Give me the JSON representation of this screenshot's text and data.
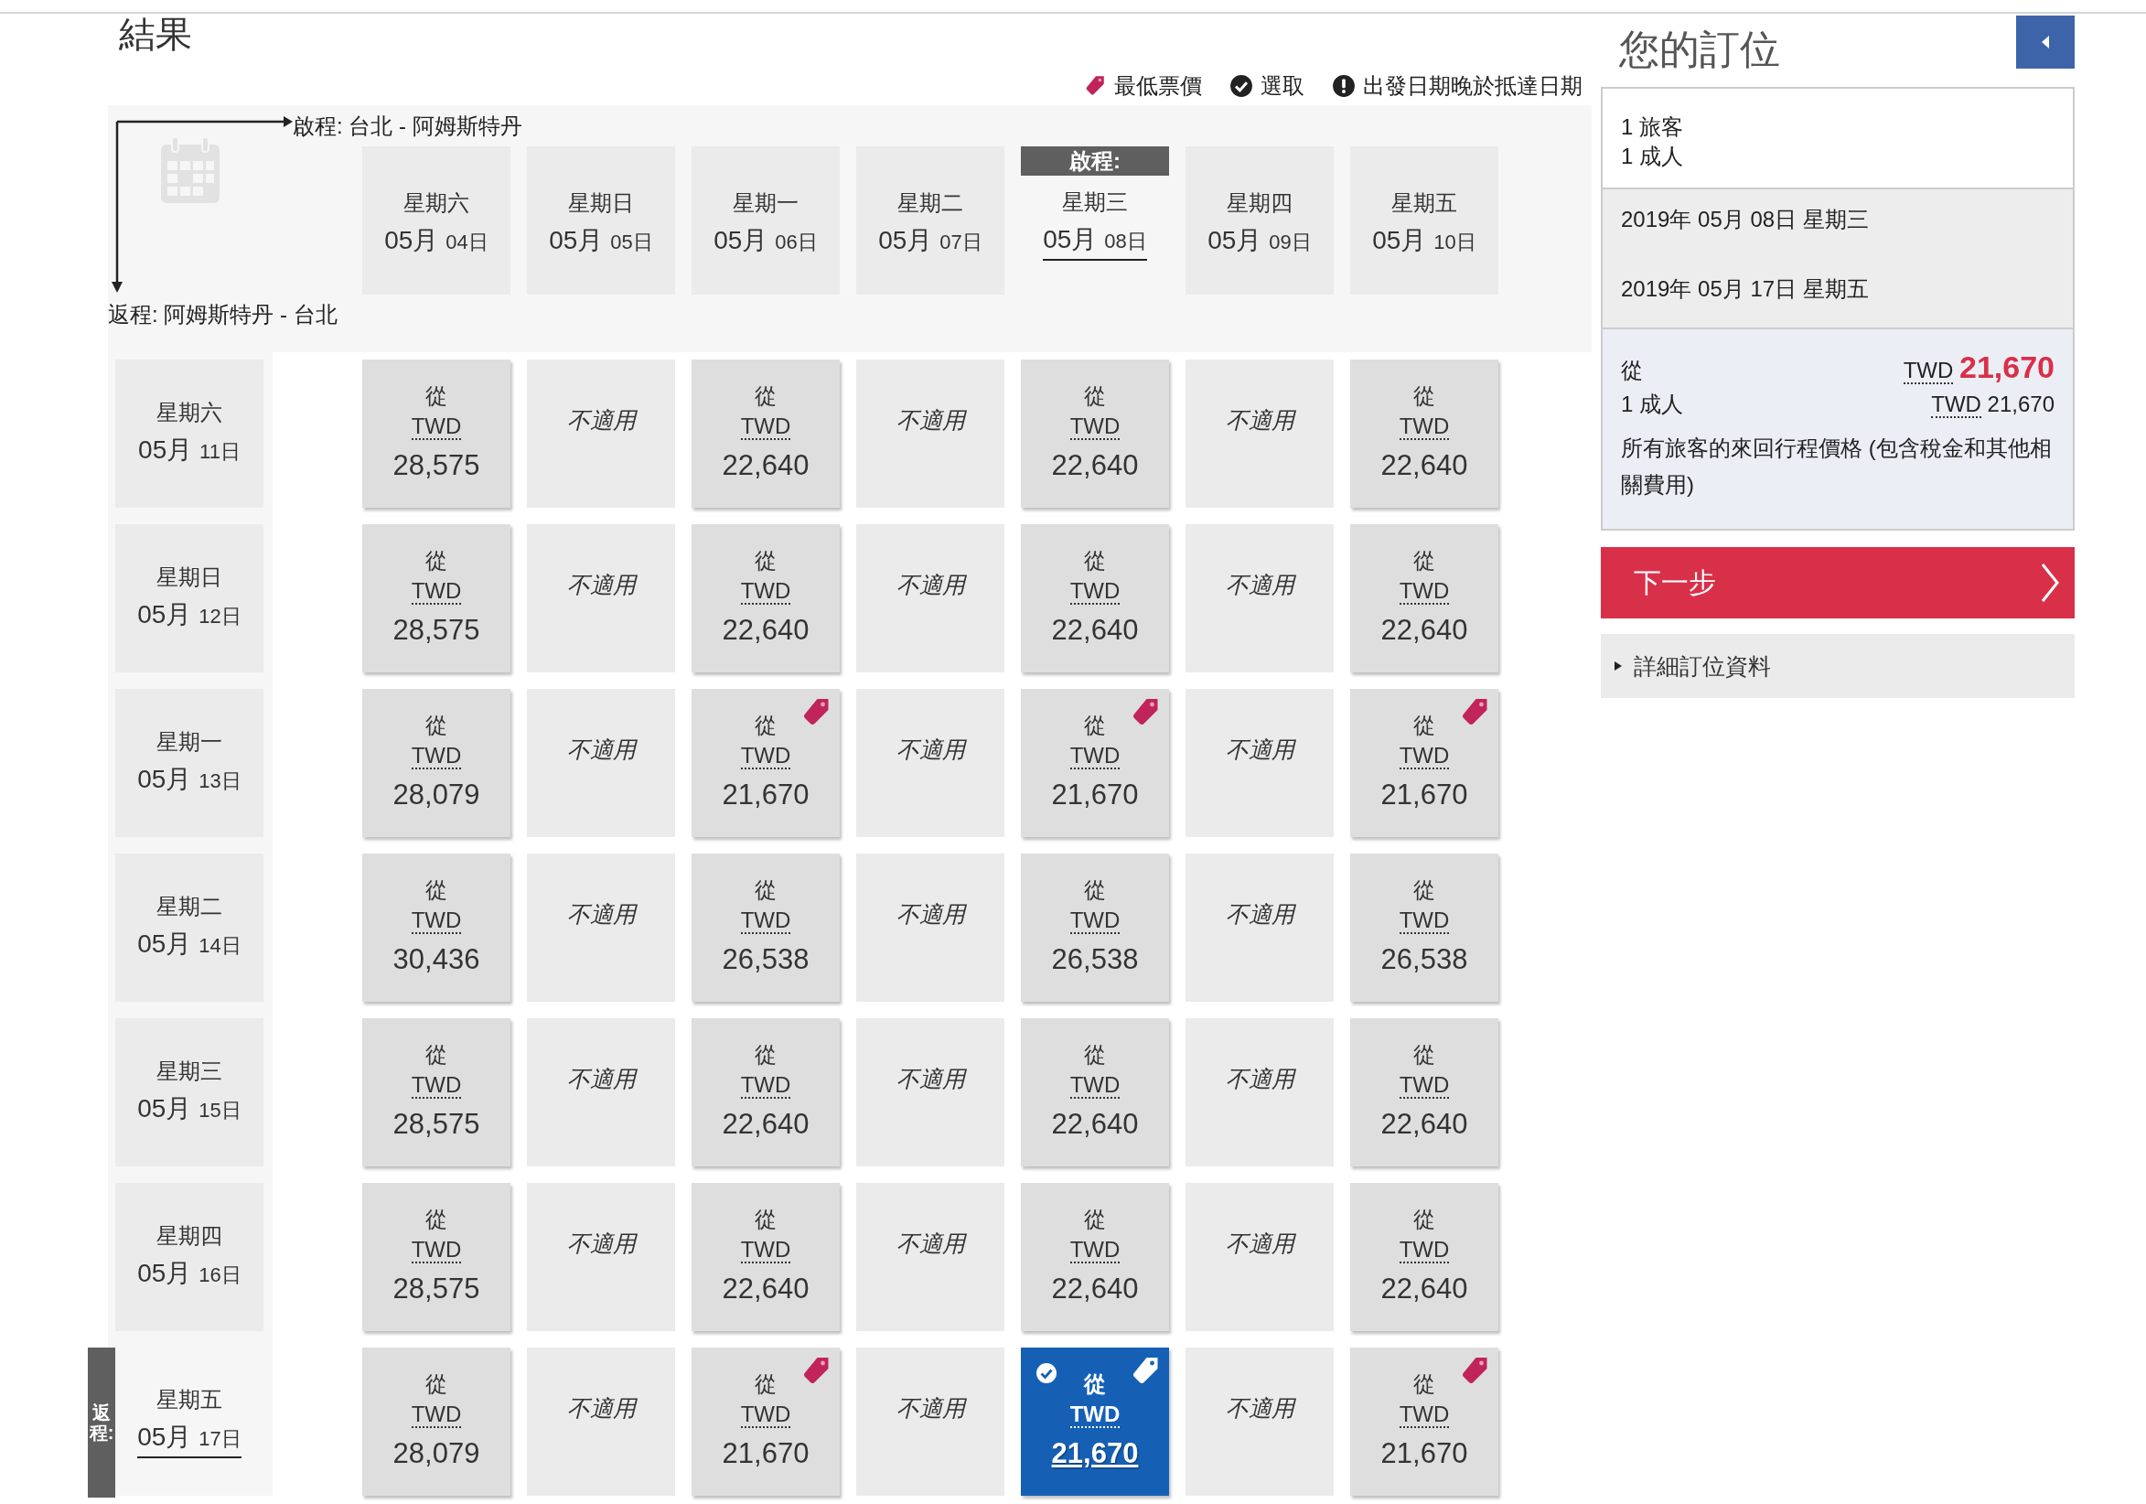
{
  "title": "結果",
  "legend": [
    {
      "kind": "lowest",
      "label": "最低票價"
    },
    {
      "kind": "selected",
      "label": "選取"
    },
    {
      "kind": "warning",
      "label": "出發日期晚於抵達日期"
    }
  ],
  "outbound_route": "啟程: 台北 - 阿姆斯特丹",
  "return_route": "返程: 阿姆斯特丹 - 台北",
  "outbound_badge": "啟程:",
  "return_badge": "返程:",
  "columns": [
    {
      "weekday": "星期六",
      "month": "05月",
      "day": "04日",
      "selected": false
    },
    {
      "weekday": "星期日",
      "month": "05月",
      "day": "05日",
      "selected": false
    },
    {
      "weekday": "星期一",
      "month": "05月",
      "day": "06日",
      "selected": false
    },
    {
      "weekday": "星期二",
      "month": "05月",
      "day": "07日",
      "selected": false
    },
    {
      "weekday": "星期三",
      "month": "05月",
      "day": "08日",
      "selected": true
    },
    {
      "weekday": "星期四",
      "month": "05月",
      "day": "09日",
      "selected": false
    },
    {
      "weekday": "星期五",
      "month": "05月",
      "day": "10日",
      "selected": false
    }
  ],
  "rows": [
    {
      "weekday": "星期六",
      "month": "05月",
      "day": "11日",
      "selected": false,
      "cells": [
        {
          "kind": "fare",
          "from": "從",
          "currency": "TWD",
          "amount": "28,575",
          "lowest": false,
          "selected": false
        },
        {
          "kind": "na",
          "text": "不適用"
        },
        {
          "kind": "fare",
          "from": "從",
          "currency": "TWD",
          "amount": "22,640",
          "lowest": false,
          "selected": false
        },
        {
          "kind": "na",
          "text": "不適用"
        },
        {
          "kind": "fare",
          "from": "從",
          "currency": "TWD",
          "amount": "22,640",
          "lowest": false,
          "selected": false
        },
        {
          "kind": "na",
          "text": "不適用"
        },
        {
          "kind": "fare",
          "from": "從",
          "currency": "TWD",
          "amount": "22,640",
          "lowest": false,
          "selected": false
        }
      ]
    },
    {
      "weekday": "星期日",
      "month": "05月",
      "day": "12日",
      "selected": false,
      "cells": [
        {
          "kind": "fare",
          "from": "從",
          "currency": "TWD",
          "amount": "28,575",
          "lowest": false,
          "selected": false
        },
        {
          "kind": "na",
          "text": "不適用"
        },
        {
          "kind": "fare",
          "from": "從",
          "currency": "TWD",
          "amount": "22,640",
          "lowest": false,
          "selected": false
        },
        {
          "kind": "na",
          "text": "不適用"
        },
        {
          "kind": "fare",
          "from": "從",
          "currency": "TWD",
          "amount": "22,640",
          "lowest": false,
          "selected": false
        },
        {
          "kind": "na",
          "text": "不適用"
        },
        {
          "kind": "fare",
          "from": "從",
          "currency": "TWD",
          "amount": "22,640",
          "lowest": false,
          "selected": false
        }
      ]
    },
    {
      "weekday": "星期一",
      "month": "05月",
      "day": "13日",
      "selected": false,
      "cells": [
        {
          "kind": "fare",
          "from": "從",
          "currency": "TWD",
          "amount": "28,079",
          "lowest": false,
          "selected": false
        },
        {
          "kind": "na",
          "text": "不適用"
        },
        {
          "kind": "fare",
          "from": "從",
          "currency": "TWD",
          "amount": "21,670",
          "lowest": true,
          "selected": false
        },
        {
          "kind": "na",
          "text": "不適用"
        },
        {
          "kind": "fare",
          "from": "從",
          "currency": "TWD",
          "amount": "21,670",
          "lowest": true,
          "selected": false
        },
        {
          "kind": "na",
          "text": "不適用"
        },
        {
          "kind": "fare",
          "from": "從",
          "currency": "TWD",
          "amount": "21,670",
          "lowest": true,
          "selected": false
        }
      ]
    },
    {
      "weekday": "星期二",
      "month": "05月",
      "day": "14日",
      "selected": false,
      "cells": [
        {
          "kind": "fare",
          "from": "從",
          "currency": "TWD",
          "amount": "30,436",
          "lowest": false,
          "selected": false
        },
        {
          "kind": "na",
          "text": "不適用"
        },
        {
          "kind": "fare",
          "from": "從",
          "currency": "TWD",
          "amount": "26,538",
          "lowest": false,
          "selected": false
        },
        {
          "kind": "na",
          "text": "不適用"
        },
        {
          "kind": "fare",
          "from": "從",
          "currency": "TWD",
          "amount": "26,538",
          "lowest": false,
          "selected": false
        },
        {
          "kind": "na",
          "text": "不適用"
        },
        {
          "kind": "fare",
          "from": "從",
          "currency": "TWD",
          "amount": "26,538",
          "lowest": false,
          "selected": false
        }
      ]
    },
    {
      "weekday": "星期三",
      "month": "05月",
      "day": "15日",
      "selected": false,
      "cells": [
        {
          "kind": "fare",
          "from": "從",
          "currency": "TWD",
          "amount": "28,575",
          "lowest": false,
          "selected": false
        },
        {
          "kind": "na",
          "text": "不適用"
        },
        {
          "kind": "fare",
          "from": "從",
          "currency": "TWD",
          "amount": "22,640",
          "lowest": false,
          "selected": false
        },
        {
          "kind": "na",
          "text": "不適用"
        },
        {
          "kind": "fare",
          "from": "從",
          "currency": "TWD",
          "amount": "22,640",
          "lowest": false,
          "selected": false
        },
        {
          "kind": "na",
          "text": "不適用"
        },
        {
          "kind": "fare",
          "from": "從",
          "currency": "TWD",
          "amount": "22,640",
          "lowest": false,
          "selected": false
        }
      ]
    },
    {
      "weekday": "星期四",
      "month": "05月",
      "day": "16日",
      "selected": false,
      "cells": [
        {
          "kind": "fare",
          "from": "從",
          "currency": "TWD",
          "amount": "28,575",
          "lowest": false,
          "selected": false
        },
        {
          "kind": "na",
          "text": "不適用"
        },
        {
          "kind": "fare",
          "from": "從",
          "currency": "TWD",
          "amount": "22,640",
          "lowest": false,
          "selected": false
        },
        {
          "kind": "na",
          "text": "不適用"
        },
        {
          "kind": "fare",
          "from": "從",
          "currency": "TWD",
          "amount": "22,640",
          "lowest": false,
          "selected": false
        },
        {
          "kind": "na",
          "text": "不適用"
        },
        {
          "kind": "fare",
          "from": "從",
          "currency": "TWD",
          "amount": "22,640",
          "lowest": false,
          "selected": false
        }
      ]
    },
    {
      "weekday": "星期五",
      "month": "05月",
      "day": "17日",
      "selected": true,
      "cells": [
        {
          "kind": "fare",
          "from": "從",
          "currency": "TWD",
          "amount": "28,079",
          "lowest": false,
          "selected": false
        },
        {
          "kind": "na",
          "text": "不適用"
        },
        {
          "kind": "fare",
          "from": "從",
          "currency": "TWD",
          "amount": "21,670",
          "lowest": true,
          "selected": false
        },
        {
          "kind": "na",
          "text": "不適用"
        },
        {
          "kind": "fare",
          "from": "從",
          "currency": "TWD",
          "amount": "21,670",
          "lowest": true,
          "selected": true
        },
        {
          "kind": "na",
          "text": "不適用"
        },
        {
          "kind": "fare",
          "from": "從",
          "currency": "TWD",
          "amount": "21,670",
          "lowest": true,
          "selected": false
        }
      ]
    }
  ],
  "booking": {
    "title": "您的訂位",
    "travelers": [
      "1 旅客",
      "1 成人"
    ],
    "dates": [
      "2019年 05月 08日 星期三",
      "2019年 05月 17日 星期五"
    ],
    "from": "從",
    "currency": "TWD",
    "total": "21,670",
    "adult_label": "1 成人",
    "adult_currency": "TWD",
    "adult_amount": "21,670",
    "note": "所有旅客的來回行程價格 (包含稅金和其他相關費用)",
    "next_button": "下一步",
    "details": "詳細訂位資料"
  }
}
